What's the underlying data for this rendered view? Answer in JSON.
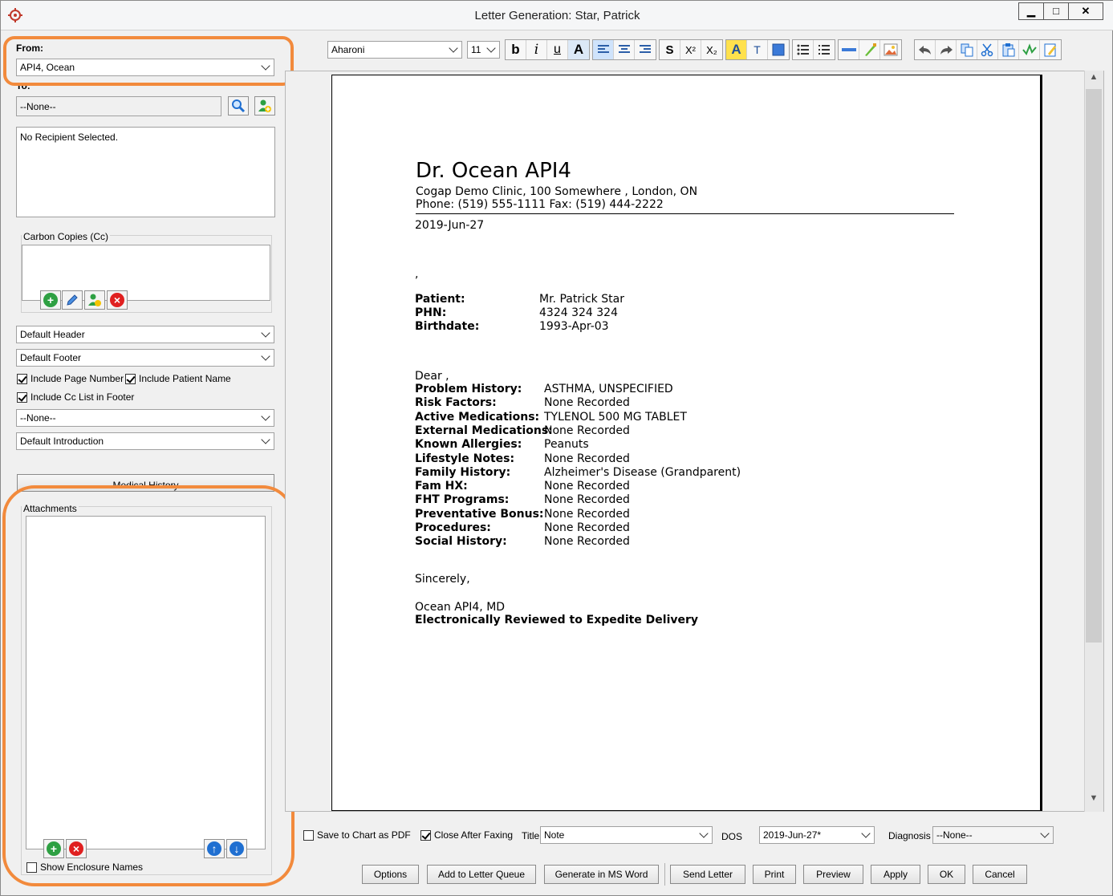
{
  "window": {
    "title": "Letter Generation: Star, Patrick",
    "controls": {
      "minimize": "▁",
      "maximize": "□",
      "close": "✕"
    }
  },
  "left": {
    "from_label": "From:",
    "from_value": "API4, Ocean",
    "to_label": "To:",
    "to_value": "--None--",
    "recipient_text": "No Recipient Selected.",
    "cc_label": "Carbon Copies (Cc)",
    "header_select": "Default Header",
    "footer_select": "Default Footer",
    "include_page_number": "Include Page Number",
    "include_patient_name": "Include Patient Name",
    "include_cc_footer": "Include Cc List in Footer",
    "none_select": "--None--",
    "intro_select": "Default Introduction",
    "medical_history_button": "Medical History",
    "attachments_label": "Attachments",
    "show_enclosure_names": "Show Enclosure Names"
  },
  "toolbar": {
    "font_name": "Aharoni",
    "font_size": "11",
    "bold": "b",
    "italic": "i",
    "underline": "u",
    "font_color": "A",
    "strike": "S",
    "superscript": "X²",
    "subscript": "X₂",
    "highlight": "A",
    "textbox": "T"
  },
  "letter": {
    "doctor_name": "Dr. Ocean API4",
    "clinic_line": "Cogap Demo Clinic, 100 Somewhere , London, ON",
    "phone_line": "Phone: (519) 555-1111 Fax: (519) 444-2222",
    "date": "2019-Jun-27",
    "comma_line": ",",
    "patient_fields": [
      {
        "label": "Patient:",
        "value": "Mr. Patrick Star"
      },
      {
        "label": "PHN:",
        "value": "4324 324 324"
      },
      {
        "label": "Birthdate:",
        "value": "1993-Apr-03"
      }
    ],
    "dear": "Dear ,",
    "history": [
      {
        "label": "Problem History:",
        "value": "ASTHMA, UNSPECIFIED"
      },
      {
        "label": "Risk Factors:",
        "value": "None Recorded"
      },
      {
        "label": "Active Medications:",
        "value": "TYLENOL 500 MG TABLET"
      },
      {
        "label": "External Medications:",
        "value": "None Recorded"
      },
      {
        "label": "Known Allergies:",
        "value": "Peanuts"
      },
      {
        "label": "Lifestyle Notes:",
        "value": "None Recorded"
      },
      {
        "label": "Family History:",
        "value": "Alzheimer's Disease (Grandparent)"
      },
      {
        "label": "Fam HX:",
        "value": "None Recorded"
      },
      {
        "label": "FHT Programs:",
        "value": "None Recorded"
      },
      {
        "label": "Preventative Bonus:",
        "value": "None Recorded"
      },
      {
        "label": "Procedures:",
        "value": "None Recorded"
      },
      {
        "label": "Social History:",
        "value": "None Recorded"
      }
    ],
    "closing": "Sincerely,",
    "signature": "Ocean API4, MD",
    "reviewed": "Electronically Reviewed to Expedite Delivery"
  },
  "bottom": {
    "save_pdf": "Save to Chart as PDF",
    "close_after_fax": "Close After Faxing",
    "title_label": "Title",
    "title_value": "Note",
    "dos_label": "DOS",
    "dos_value": "2019-Jun-27*",
    "diagnosis_label": "Diagnosis",
    "diagnosis_value": "--None--",
    "buttons": {
      "options": "Options",
      "add_queue": "Add to Letter Queue",
      "generate_word": "Generate in MS Word",
      "send": "Send Letter",
      "print": "Print",
      "preview": "Preview",
      "apply": "Apply",
      "ok": "OK",
      "cancel": "Cancel"
    }
  },
  "colors": {
    "highlight": "#f28a3c",
    "green": "#2ea043",
    "red": "#e02020",
    "blue": "#1f6fd1"
  }
}
